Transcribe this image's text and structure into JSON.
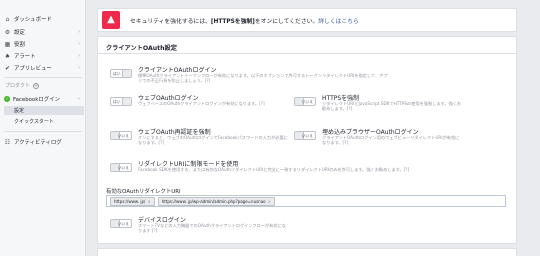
{
  "sidebar": {
    "items": [
      {
        "label": "ダッシュボード",
        "icon": "home-icon",
        "glyph": "⌂",
        "chev": ""
      },
      {
        "label": "設定",
        "icon": "gear-icon",
        "glyph": "⚙",
        "chev": "›"
      },
      {
        "label": "役割",
        "icon": "roles-icon",
        "glyph": "▦",
        "chev": "›"
      },
      {
        "label": "アラート",
        "icon": "bell-icon",
        "glyph": "♠",
        "chev": "›"
      },
      {
        "label": "アプリレビュー",
        "icon": "check-circle-icon",
        "glyph": "✔",
        "chev": "›"
      }
    ],
    "products_label": "プロダクト",
    "products_add": "+",
    "product": {
      "label": "Facebookログイン",
      "chev": "›"
    },
    "sub_items": [
      "設定",
      "クイックスタート"
    ],
    "activity": {
      "label": "アクティビティログ",
      "glyph": "☷"
    }
  },
  "alert": {
    "text_pre": "セキュリティを強化するには、",
    "text_bold": "[HTTPSを強制]",
    "text_post": "をオンにしてください。",
    "link": "詳しくはこちら"
  },
  "panel": {
    "title": "クライアントOAuth設定",
    "settings": [
      {
        "title": "クライアントOAuthログイン",
        "desc": "標準OAuthクライアントトークンフローが有効になります。以下のオプションで許可するトークンリダイレクトURIを指定して、アプリでの不正行為を防止しましょう。[?]",
        "state": "on",
        "toggle": "はい"
      },
      {
        "title": "ウェブOAuthログイン",
        "desc": "ウェブベースのOAuthクライアントログインが有効になります。[?]",
        "state": "on",
        "toggle": "はい"
      },
      {
        "title": "HTTPSを強制",
        "desc": "リダイレクトURIとJavaScript SDKでHTTPSの使用を強制します。強くお勧めします。[?]",
        "state": "off",
        "toggle": "いいえ"
      },
      {
        "title": "ウェブOAuth再認証を強制",
        "desc": "オンにすると、ウェブのOAuthログインでFacebookパスワードの入力が必要になります。[?]",
        "state": "off",
        "toggle": "いいえ"
      },
      {
        "title": "埋め込みブラウザーOAuthログイン",
        "desc": "クライアントOAuthログイン用のウェブビューリダイレクトURIが有効になります。[?]",
        "state": "off",
        "toggle": "いいえ"
      },
      {
        "title": "リダイレクトURIに制限モードを使用",
        "desc": "Facebook SDKを使用する、または有効なOAuthリダイレクトURIと完全に一致するリダイレクトURIのみを許可します。強くお勧めします。[?]",
        "state": "off",
        "toggle": "いいえ"
      },
      {
        "title": "デバイスログイン",
        "desc": "スマートTVなどの入力機器でのOAuthクライアントログインフローが有効になります [?]",
        "state": "off",
        "toggle": "いいえ"
      }
    ],
    "uri_label": "有効なOAuthリダイレクトURI",
    "uris": [
      {
        "text": "https://www.                  jp/",
        "x": "×"
      },
      {
        "text": "https://www.               jp/wp-admin/admin.php?page=nusnao",
        "x": "×"
      }
    ]
  }
}
